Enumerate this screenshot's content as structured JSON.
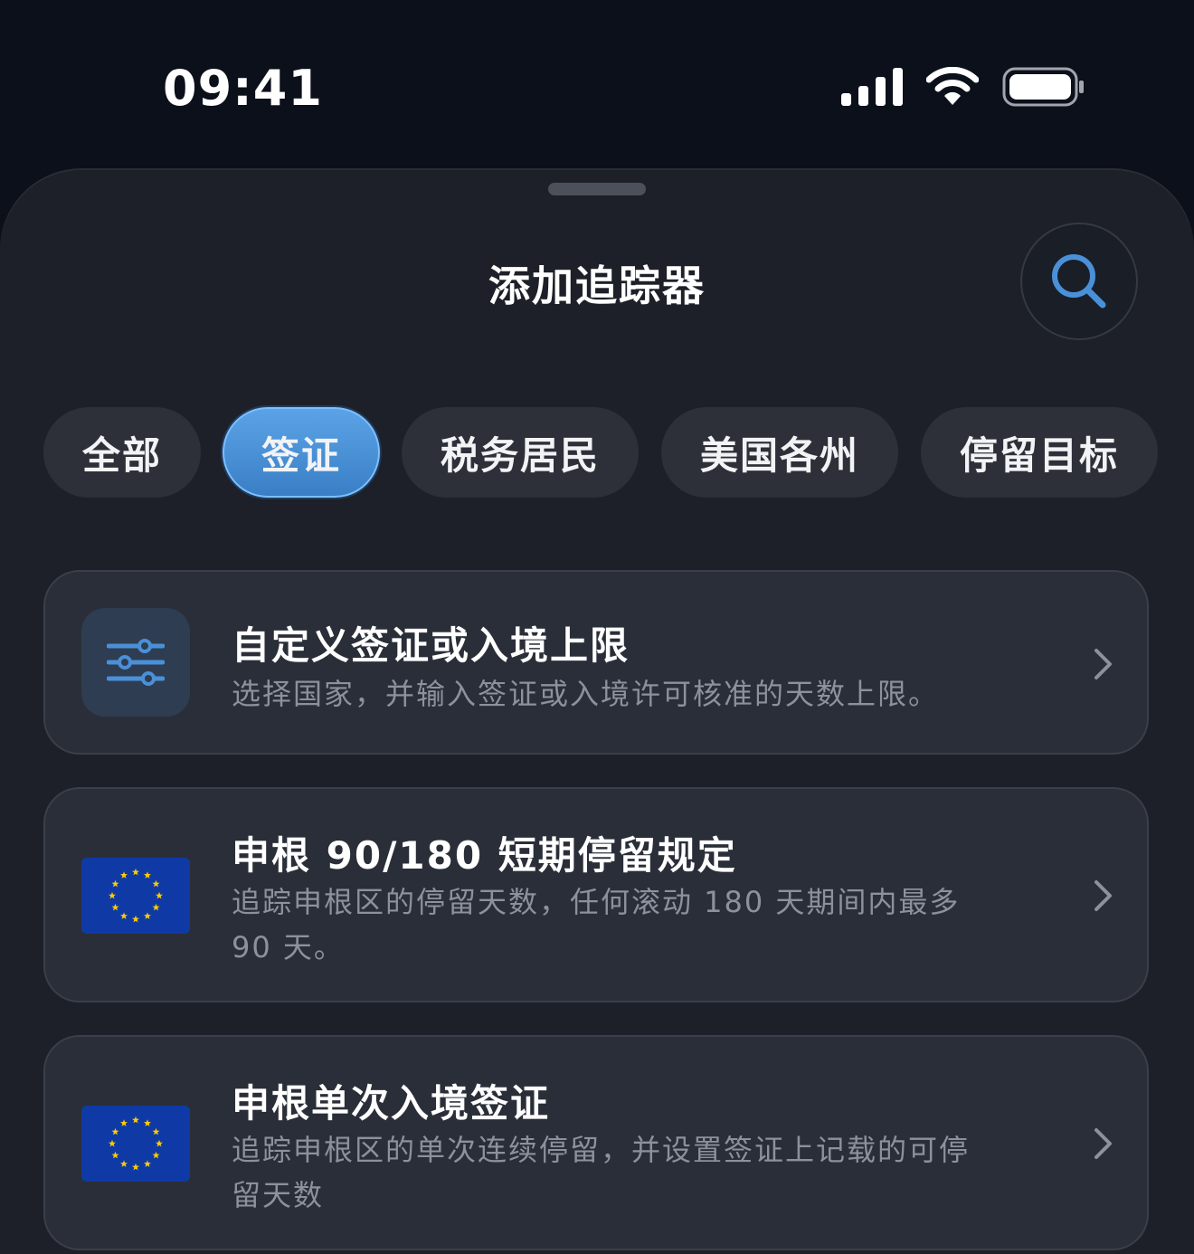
{
  "status_bar": {
    "time": "09:41"
  },
  "sheet": {
    "title": "添加追踪器"
  },
  "tabs": [
    {
      "label": "全部",
      "active": false
    },
    {
      "label": "签证",
      "active": true
    },
    {
      "label": "税务居民",
      "active": false
    },
    {
      "label": "美国各州",
      "active": false
    },
    {
      "label": "停留目标",
      "active": false
    }
  ],
  "cards": [
    {
      "icon": "sliders-icon",
      "title": "自定义签证或入境上限",
      "description": "选择国家，并输入签证或入境许可核准的天数上限。"
    },
    {
      "icon": "eu-flag-icon",
      "title": "申根 90/180 短期停留规定",
      "description": "追踪申根区的停留天数，任何滚动 180 天期间内最多 90 天。"
    },
    {
      "icon": "eu-flag-icon",
      "title": "申根单次入境签证",
      "description": "追踪申根区的单次连续停留，并设置签证上记载的可停留天数"
    }
  ],
  "colors": {
    "accent": "#4a90d9",
    "background": "#1d2028",
    "card": "#2a2e38",
    "eu_blue": "#0f3aa6",
    "eu_gold": "#ffcc00"
  }
}
